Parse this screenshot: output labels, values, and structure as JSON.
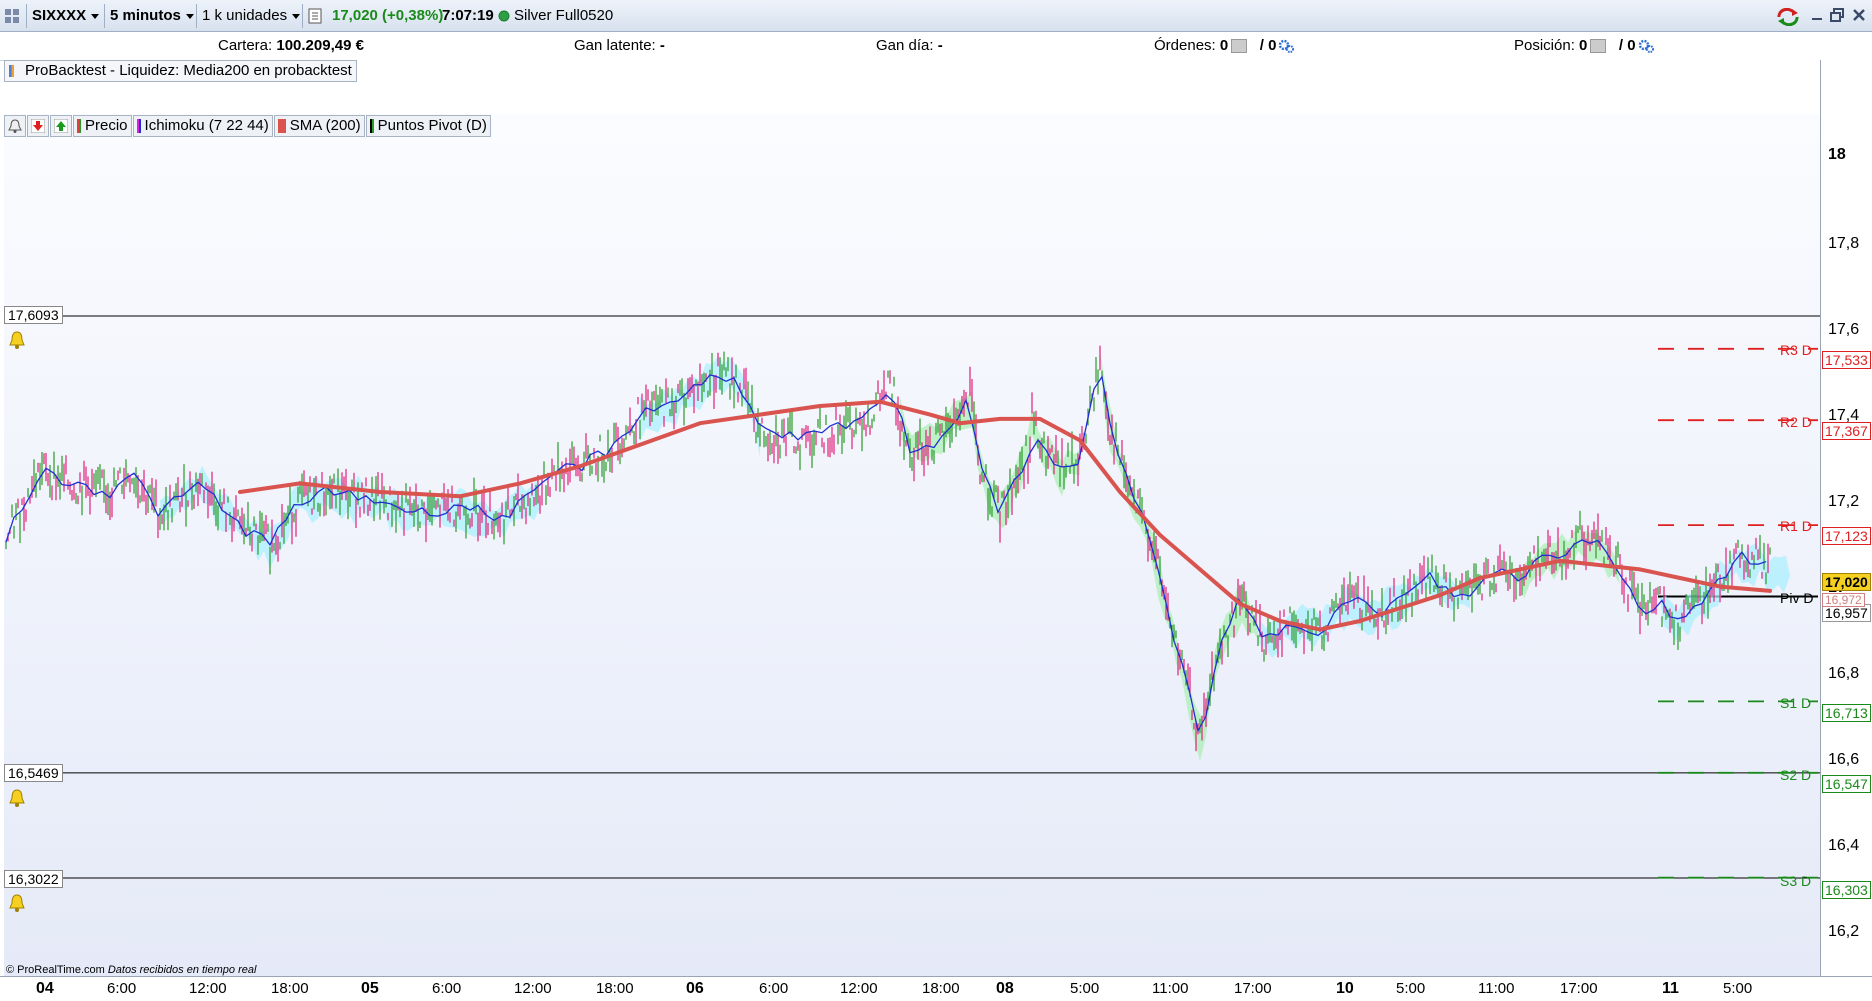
{
  "toolbar": {
    "symbol": "SIXXXX",
    "interval": "5 minutos",
    "units": "1 k unidades",
    "price": "17,020 (+0,38%)",
    "time": "7:07:19",
    "account": "Silver Full0520",
    "status_color": "#2ea043"
  },
  "infobar": {
    "cartera_label": "Cartera:",
    "cartera_value": "100.209,49 €",
    "gan_latente_label": "Gan latente:",
    "gan_latente_value": "-",
    "gan_dia_label": "Gan día:",
    "gan_dia_value": "-",
    "ordenes_label": "Órdenes:",
    "ordenes_a": "0",
    "ordenes_b": "/ 0",
    "posicion_label": "Posición:",
    "posicion_a": "0",
    "posicion_b": "/ 0"
  },
  "backtest_label": "ProBacktest - Liquidez: Media200 en probacktest",
  "legend": {
    "precio": "Precio",
    "ichimoku": "Ichimoku (7 22 44)",
    "sma": "SMA (200)",
    "pivots": "Puntos Pivot (D)"
  },
  "hlines": {
    "top": "17,6093",
    "bottom": "16,5469",
    "bottom2": "16,3022"
  },
  "pivots": [
    {
      "name": "R3 D",
      "value": "17,533",
      "color": "#e02020"
    },
    {
      "name": "R2 D",
      "value": "17,367",
      "color": "#e02020"
    },
    {
      "name": "R1 D",
      "value": "17,123",
      "color": "#e02020"
    },
    {
      "name": "Piv D",
      "value": "16,957",
      "color": "#000000"
    },
    {
      "name": "S1 D",
      "value": "16,713",
      "color": "#1a8a1a"
    },
    {
      "name": "S2 D",
      "value": "16,547",
      "color": "#1a8a1a"
    },
    {
      "name": "S3 D",
      "value": "16,303",
      "color": "#1a8a1a"
    }
  ],
  "current_price_tag": "17,020",
  "hidden_tag": "16,972",
  "y_axis": [
    "18",
    "17,8",
    "17,6",
    "17,4",
    "17,2",
    "17",
    "16,8",
    "16,6",
    "16,4",
    "16,2"
  ],
  "x_axis": [
    {
      "label": "04",
      "bold": true
    },
    {
      "label": "6:00"
    },
    {
      "label": "12:00"
    },
    {
      "label": "18:00"
    },
    {
      "label": "05",
      "bold": true
    },
    {
      "label": "6:00"
    },
    {
      "label": "12:00"
    },
    {
      "label": "18:00"
    },
    {
      "label": "06",
      "bold": true
    },
    {
      "label": "6:00"
    },
    {
      "label": "12:00"
    },
    {
      "label": "18:00"
    },
    {
      "label": "08",
      "bold": true
    },
    {
      "label": "5:00"
    },
    {
      "label": "11:00"
    },
    {
      "label": "17:00"
    },
    {
      "label": "10",
      "bold": true
    },
    {
      "label": "5:00"
    },
    {
      "label": "11:00"
    },
    {
      "label": "17:00"
    },
    {
      "label": "11",
      "bold": true
    },
    {
      "label": "5:00"
    }
  ],
  "copyright": "© ProRealTime.com",
  "copyright_note": "Datos recibidos en tiempo real",
  "colors": {
    "sma": "#d9534f",
    "ichimoku": "#2030d0",
    "cloud": "#a8f0ff",
    "cloud2": "#a8f0b0",
    "up": "#2a9a2a",
    "down": "#e0207a"
  }
}
